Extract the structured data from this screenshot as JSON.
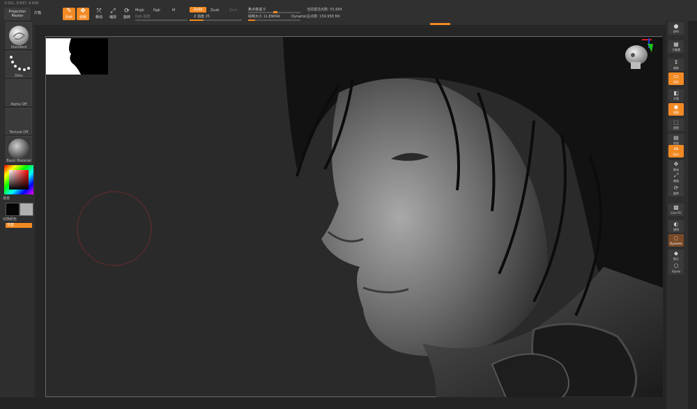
{
  "app": {
    "coords": "3.011, 0.637, 0.026",
    "colors": {
      "accent": "#f28a24",
      "panel": "#303030",
      "canvas": "#262626",
      "bg": "#2b2b2b",
      "brush_ring": "#8a2b30"
    }
  },
  "toolbar": {
    "projection_master": "Projection Master",
    "light_label": "灯箱",
    "edit_label": "Edit",
    "draw_label": "绘制",
    "move_label": "移动",
    "scale_label": "缩放",
    "rotate_label": "旋转",
    "mrgb_label": "Mrgb",
    "rgb_label": "Rgb",
    "m_label": "M",
    "rgb_intensity_label": "Rgb 强度",
    "zadd_label": "Zadd",
    "zsub_label": "Zsub",
    "zcut_label": "Zcut",
    "z_intensity": "Z 强度 25",
    "focal_shift": "焦点衰减 0",
    "draw_size": "绘制大小 11.89094",
    "dynamic_label": "Dynamic",
    "active_points": "当前激活点数: 55,684",
    "total_points": "总点数: 159.958 Mil"
  },
  "left_shelf": {
    "brush_label": "Standard",
    "stroke_label": "Dots",
    "alpha_label": "Alpha Off",
    "texture_label": "Texture Off",
    "material_label": "Basic Material",
    "gradient_label": "渐变",
    "switch_color_label": "切换颜色",
    "alternate_label": "交替"
  },
  "right_shelf": {
    "items": [
      {
        "label": "BPR",
        "icon": "sphere-icon"
      },
      {
        "label": "子像素",
        "icon": "grid-icon"
      },
      {
        "label": "缩放",
        "icon": "scroll-icon"
      },
      {
        "label": "实际",
        "icon": "rect-icon"
      },
      {
        "label": "半宽",
        "icon": "halfrect-icon"
      },
      {
        "label": "视图",
        "icon": "camera-icon"
      },
      {
        "label": "透视",
        "icon": "perspective-icon"
      },
      {
        "label": "地面",
        "icon": "floor-icon"
      },
      {
        "label": "Sym",
        "icon": "sym-icon"
      },
      {
        "label": "移动",
        "icon": "move-icon"
      },
      {
        "label": "缩放",
        "icon": "scale-icon"
      },
      {
        "label": "旋转",
        "icon": "rotate-icon"
      },
      {
        "label": "Line Fill",
        "icon": "polyf-icon"
      },
      {
        "label": "透明",
        "icon": "transp-icon"
      },
      {
        "label": "Dynamic",
        "icon": "ghost-icon"
      },
      {
        "label": "独立",
        "icon": "solo-icon"
      },
      {
        "label": "Xpose",
        "icon": "xpose-icon"
      }
    ]
  }
}
